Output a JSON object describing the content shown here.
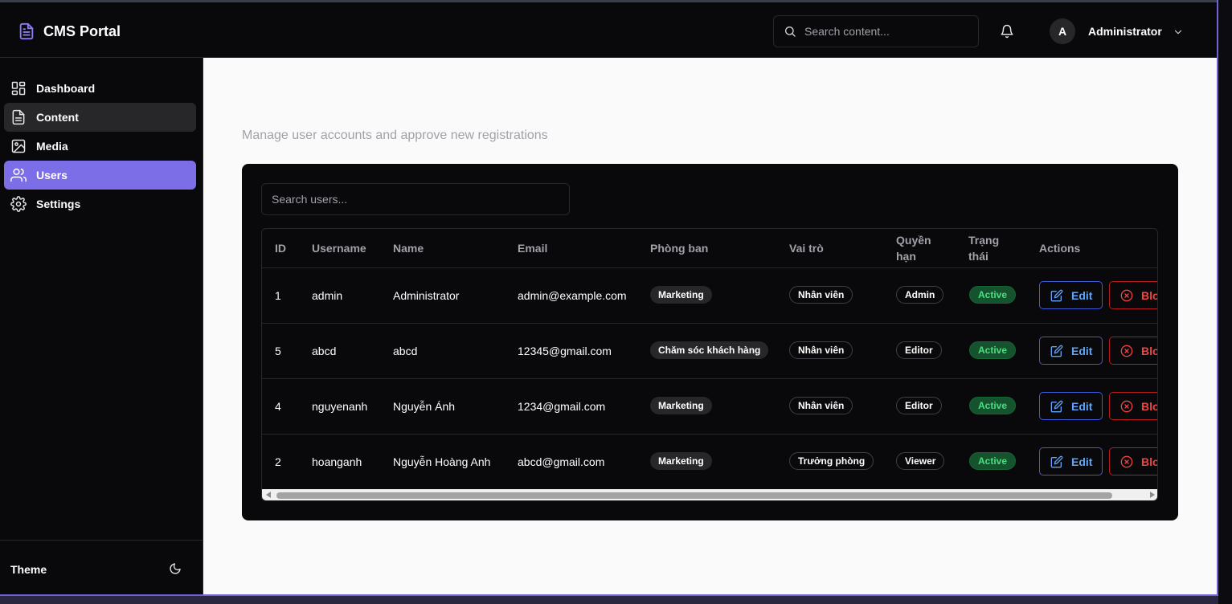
{
  "app": {
    "title": "CMS Portal"
  },
  "header": {
    "search_placeholder": "Search content...",
    "user": {
      "initial": "A",
      "name": "Administrator"
    }
  },
  "sidebar": {
    "items": [
      {
        "label": "Dashboard",
        "icon": "dashboard-icon"
      },
      {
        "label": "Content",
        "icon": "file-text-icon"
      },
      {
        "label": "Media",
        "icon": "image-icon"
      },
      {
        "label": "Users",
        "icon": "users-icon"
      },
      {
        "label": "Settings",
        "icon": "gear-icon"
      }
    ],
    "active": "Users",
    "theme_label": "Theme"
  },
  "main": {
    "subtitle": "Manage user accounts and approve new registrations",
    "search_placeholder": "Search users...",
    "columns": {
      "id": "ID",
      "username": "Username",
      "name": "Name",
      "email": "Email",
      "department": "Phòng ban",
      "role": "Vai trò",
      "permission_1": "Quyền",
      "permission_2": "hạn",
      "status_1": "Trạng",
      "status_2": "thái",
      "actions": "Actions"
    },
    "edit_label": "Edit",
    "block_label": "Blo",
    "rows": [
      {
        "id": "1",
        "username": "admin",
        "name": "Administrator",
        "email": "admin@example.com",
        "department": "Marketing",
        "role": "Nhân viên",
        "permission": "Admin",
        "status": "Active"
      },
      {
        "id": "5",
        "username": "abcd",
        "name": "abcd",
        "email": "12345@gmail.com",
        "department": "Chăm sóc khách hàng",
        "role": "Nhân viên",
        "permission": "Editor",
        "status": "Active"
      },
      {
        "id": "4",
        "username": "nguyenanh",
        "name": "Nguyễn Ánh",
        "email": "1234@gmail.com",
        "department": "Marketing",
        "role": "Nhân viên",
        "permission": "Editor",
        "status": "Active"
      },
      {
        "id": "2",
        "username": "hoanganh",
        "name": "Nguyễn Hoàng Anh",
        "email": "abcd@gmail.com",
        "department": "Marketing",
        "role": "Trưởng phòng",
        "permission": "Viewer",
        "status": "Active"
      }
    ]
  },
  "colors": {
    "accent": "#7c6ee6",
    "status_active_bg": "#14532d",
    "status_active_text": "#4ade80",
    "edit": "#60a5fa",
    "block": "#ef4444"
  }
}
